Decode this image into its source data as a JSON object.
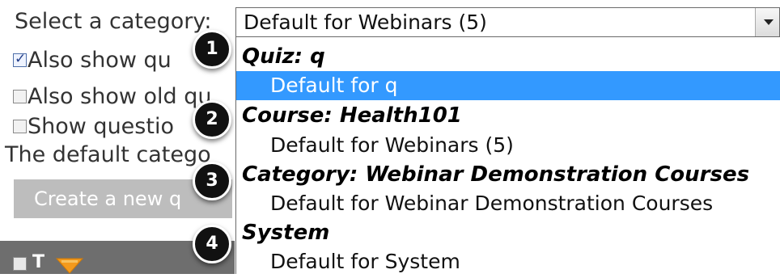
{
  "select_label": "Select a category:",
  "select_value": "Default for Webinars (5)",
  "checkboxes": [
    {
      "label": "Also show qu",
      "checked": true
    },
    {
      "label": "Also show old qu",
      "checked": false
    },
    {
      "label": "Show questio",
      "checked": false
    }
  ],
  "default_category_text": "The default catego",
  "create_button_label": "Create a new q",
  "table_head_cell": "T",
  "dropdown": {
    "groups": [
      {
        "title": "Quiz: q",
        "options": [
          {
            "label": "Default for q",
            "selected": true
          }
        ]
      },
      {
        "title": "Course: Health101",
        "options": [
          {
            "label": "Default for Webinars (5)",
            "selected": false
          }
        ]
      },
      {
        "title": "Category: Webinar Demonstration Courses",
        "options": [
          {
            "label": "Default for Webinar Demonstration Courses",
            "selected": false
          }
        ]
      },
      {
        "title": "System",
        "options": [
          {
            "label": "Default for System",
            "selected": false
          }
        ]
      }
    ]
  },
  "step_markers": [
    "1",
    "2",
    "3",
    "4"
  ],
  "colors": {
    "selected_option_bg": "#3399ff",
    "marker_bg": "#111111",
    "button_bg": "#bdbdbd",
    "table_head_bg": "#6e6e6e"
  }
}
